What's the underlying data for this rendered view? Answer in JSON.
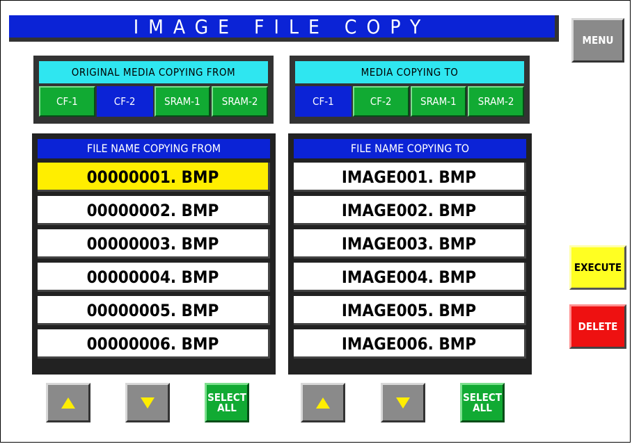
{
  "title": "IMAGE FILE COPY",
  "menu_label": "MENU",
  "source_media": {
    "header": "ORIGINAL MEDIA COPYING FROM",
    "tabs": [
      "CF-1",
      "CF-2",
      "SRAM-1",
      "SRAM-2"
    ],
    "selected": "CF-2"
  },
  "dest_media": {
    "header": "MEDIA COPYING TO",
    "tabs": [
      "CF-1",
      "CF-2",
      "SRAM-1",
      "SRAM-2"
    ],
    "selected": "CF-1"
  },
  "source_files": {
    "header": "FILE NAME COPYING FROM",
    "items": [
      "00000001. BMP",
      "00000002. BMP",
      "00000003. BMP",
      "00000004. BMP",
      "00000005. BMP",
      "00000006. BMP"
    ],
    "selected_index": 0
  },
  "dest_files": {
    "header": "FILE NAME COPYING TO",
    "items": [
      "IMAGE001. BMP",
      "IMAGE002. BMP",
      "IMAGE003. BMP",
      "IMAGE004. BMP",
      "IMAGE005. BMP",
      "IMAGE006. BMP"
    ]
  },
  "select_all": {
    "line1": "SELECT",
    "line2": "ALL"
  },
  "execute_label": "EXECUTE",
  "delete_label": "DELETE",
  "icons": {
    "up": "up-arrow-icon",
    "down": "down-arrow-icon"
  },
  "colors": {
    "title_bg": "#0b23d6",
    "selected_row": "#ffee00",
    "tab_green": "#11aa33",
    "media_header": "#2fe6f0"
  }
}
